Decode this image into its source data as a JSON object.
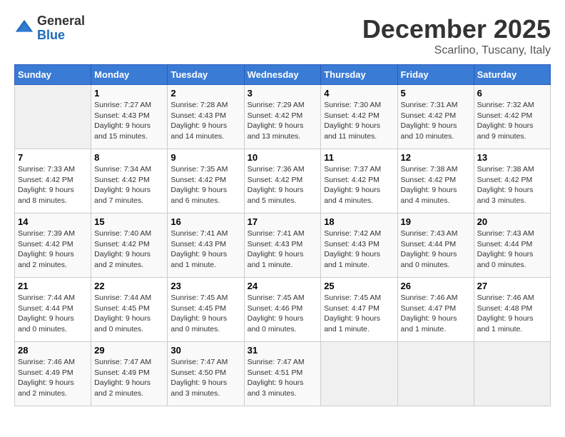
{
  "logo": {
    "general": "General",
    "blue": "Blue"
  },
  "header": {
    "month": "December 2025",
    "location": "Scarlino, Tuscany, Italy"
  },
  "weekdays": [
    "Sunday",
    "Monday",
    "Tuesday",
    "Wednesday",
    "Thursday",
    "Friday",
    "Saturday"
  ],
  "weeks": [
    [
      {
        "num": "",
        "info": ""
      },
      {
        "num": "1",
        "info": "Sunrise: 7:27 AM\nSunset: 4:43 PM\nDaylight: 9 hours\nand 15 minutes."
      },
      {
        "num": "2",
        "info": "Sunrise: 7:28 AM\nSunset: 4:43 PM\nDaylight: 9 hours\nand 14 minutes."
      },
      {
        "num": "3",
        "info": "Sunrise: 7:29 AM\nSunset: 4:42 PM\nDaylight: 9 hours\nand 13 minutes."
      },
      {
        "num": "4",
        "info": "Sunrise: 7:30 AM\nSunset: 4:42 PM\nDaylight: 9 hours\nand 11 minutes."
      },
      {
        "num": "5",
        "info": "Sunrise: 7:31 AM\nSunset: 4:42 PM\nDaylight: 9 hours\nand 10 minutes."
      },
      {
        "num": "6",
        "info": "Sunrise: 7:32 AM\nSunset: 4:42 PM\nDaylight: 9 hours\nand 9 minutes."
      }
    ],
    [
      {
        "num": "7",
        "info": "Sunrise: 7:33 AM\nSunset: 4:42 PM\nDaylight: 9 hours\nand 8 minutes."
      },
      {
        "num": "8",
        "info": "Sunrise: 7:34 AM\nSunset: 4:42 PM\nDaylight: 9 hours\nand 7 minutes."
      },
      {
        "num": "9",
        "info": "Sunrise: 7:35 AM\nSunset: 4:42 PM\nDaylight: 9 hours\nand 6 minutes."
      },
      {
        "num": "10",
        "info": "Sunrise: 7:36 AM\nSunset: 4:42 PM\nDaylight: 9 hours\nand 5 minutes."
      },
      {
        "num": "11",
        "info": "Sunrise: 7:37 AM\nSunset: 4:42 PM\nDaylight: 9 hours\nand 4 minutes."
      },
      {
        "num": "12",
        "info": "Sunrise: 7:38 AM\nSunset: 4:42 PM\nDaylight: 9 hours\nand 4 minutes."
      },
      {
        "num": "13",
        "info": "Sunrise: 7:38 AM\nSunset: 4:42 PM\nDaylight: 9 hours\nand 3 minutes."
      }
    ],
    [
      {
        "num": "14",
        "info": "Sunrise: 7:39 AM\nSunset: 4:42 PM\nDaylight: 9 hours\nand 2 minutes."
      },
      {
        "num": "15",
        "info": "Sunrise: 7:40 AM\nSunset: 4:42 PM\nDaylight: 9 hours\nand 2 minutes."
      },
      {
        "num": "16",
        "info": "Sunrise: 7:41 AM\nSunset: 4:43 PM\nDaylight: 9 hours\nand 1 minute."
      },
      {
        "num": "17",
        "info": "Sunrise: 7:41 AM\nSunset: 4:43 PM\nDaylight: 9 hours\nand 1 minute."
      },
      {
        "num": "18",
        "info": "Sunrise: 7:42 AM\nSunset: 4:43 PM\nDaylight: 9 hours\nand 1 minute."
      },
      {
        "num": "19",
        "info": "Sunrise: 7:43 AM\nSunset: 4:44 PM\nDaylight: 9 hours\nand 0 minutes."
      },
      {
        "num": "20",
        "info": "Sunrise: 7:43 AM\nSunset: 4:44 PM\nDaylight: 9 hours\nand 0 minutes."
      }
    ],
    [
      {
        "num": "21",
        "info": "Sunrise: 7:44 AM\nSunset: 4:44 PM\nDaylight: 9 hours\nand 0 minutes."
      },
      {
        "num": "22",
        "info": "Sunrise: 7:44 AM\nSunset: 4:45 PM\nDaylight: 9 hours\nand 0 minutes."
      },
      {
        "num": "23",
        "info": "Sunrise: 7:45 AM\nSunset: 4:45 PM\nDaylight: 9 hours\nand 0 minutes."
      },
      {
        "num": "24",
        "info": "Sunrise: 7:45 AM\nSunset: 4:46 PM\nDaylight: 9 hours\nand 0 minutes."
      },
      {
        "num": "25",
        "info": "Sunrise: 7:45 AM\nSunset: 4:47 PM\nDaylight: 9 hours\nand 1 minute."
      },
      {
        "num": "26",
        "info": "Sunrise: 7:46 AM\nSunset: 4:47 PM\nDaylight: 9 hours\nand 1 minute."
      },
      {
        "num": "27",
        "info": "Sunrise: 7:46 AM\nSunset: 4:48 PM\nDaylight: 9 hours\nand 1 minute."
      }
    ],
    [
      {
        "num": "28",
        "info": "Sunrise: 7:46 AM\nSunset: 4:49 PM\nDaylight: 9 hours\nand 2 minutes."
      },
      {
        "num": "29",
        "info": "Sunrise: 7:47 AM\nSunset: 4:49 PM\nDaylight: 9 hours\nand 2 minutes."
      },
      {
        "num": "30",
        "info": "Sunrise: 7:47 AM\nSunset: 4:50 PM\nDaylight: 9 hours\nand 3 minutes."
      },
      {
        "num": "31",
        "info": "Sunrise: 7:47 AM\nSunset: 4:51 PM\nDaylight: 9 hours\nand 3 minutes."
      },
      {
        "num": "",
        "info": ""
      },
      {
        "num": "",
        "info": ""
      },
      {
        "num": "",
        "info": ""
      }
    ]
  ]
}
